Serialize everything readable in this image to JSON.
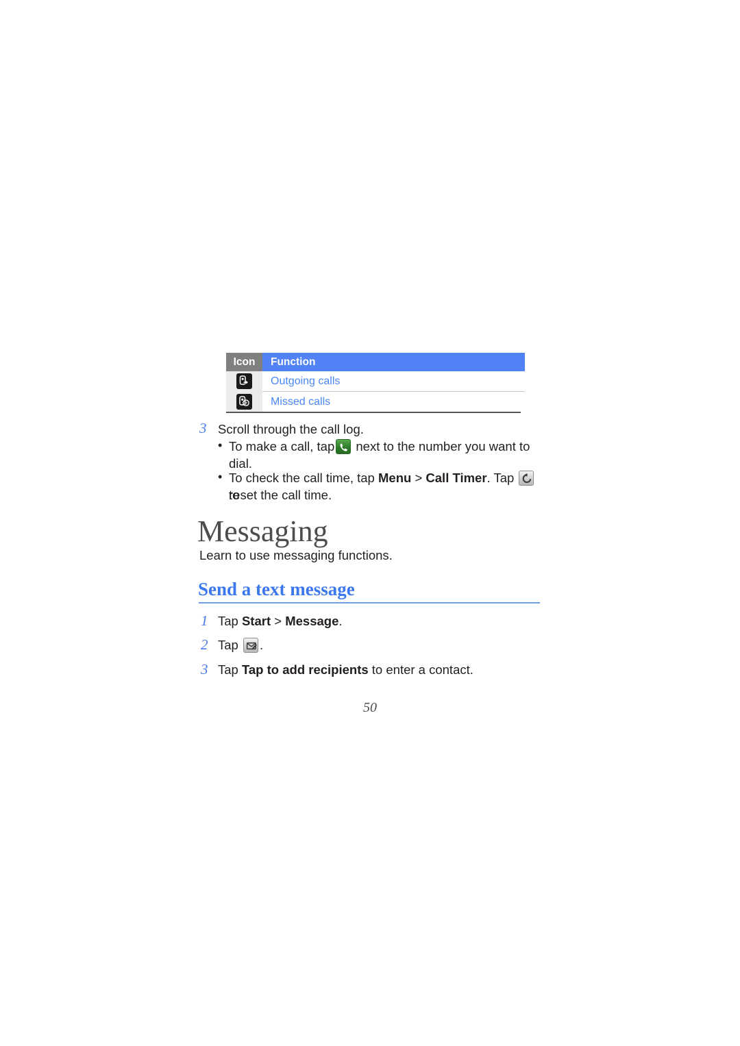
{
  "page": {
    "number": "50"
  },
  "icon_table": {
    "headers": {
      "icon": "Icon",
      "function": "Function"
    },
    "rows": [
      {
        "icon_name": "outgoing-calls-icon",
        "function": "Outgoing calls"
      },
      {
        "icon_name": "missed-calls-icon",
        "function": "Missed calls"
      }
    ],
    "colors": {
      "header_icon_bg": "#7f7f7f",
      "header_function_bg": "#5183f7",
      "icon_cell_bg": "#ebebeb",
      "row_text": "#4a86f7"
    }
  },
  "step3_calllog": {
    "number": "3",
    "text": "Scroll through the call log.",
    "bullets": [
      {
        "prefix": "To make a call, tap",
        "icon_name": "green-call-icon",
        "suffix_line1": "next to the number you want to",
        "suffix_line2": "dial."
      },
      {
        "prefix": "To check the call time, tap",
        "bold1": "Menu",
        "separator": ">",
        "bold2": "Call Timer",
        "mid": ". Tap",
        "icon_name": "reset-icon",
        "suffix_line1": "to",
        "suffix_line2": "reset the call time."
      }
    ]
  },
  "messaging_section": {
    "title": "Messaging",
    "subtitle": "Learn to use messaging functions."
  },
  "send_text_section": {
    "title": "Send a text message",
    "steps": [
      {
        "number": "1",
        "prefix": "Tap ",
        "bold1": "Start",
        "separator": " > ",
        "bold2": "Message",
        "suffix": "."
      },
      {
        "number": "2",
        "prefix": "Tap ",
        "icon_name": "compose-message-icon",
        "suffix": "."
      },
      {
        "number": "3",
        "prefix": "Tap ",
        "bold1": "Tap to add recipients",
        "suffix": " to enter a contact."
      }
    ]
  }
}
